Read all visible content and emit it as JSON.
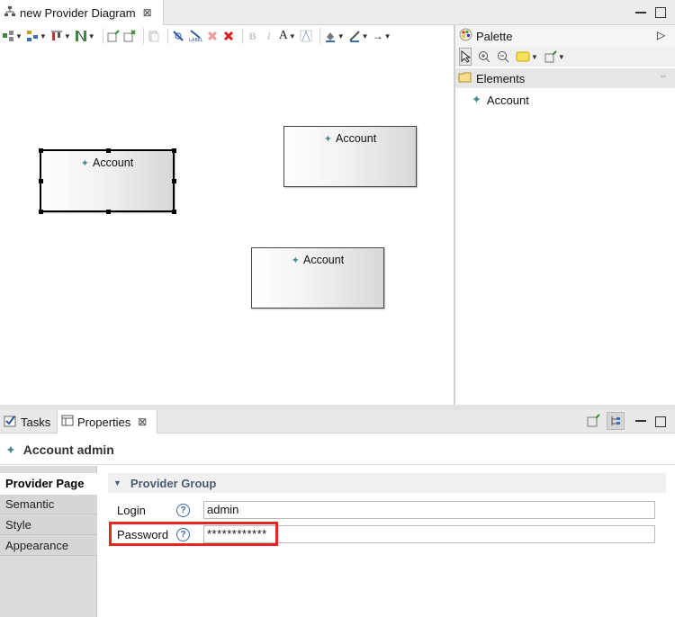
{
  "editor": {
    "tab_title": "new Provider Diagram",
    "close_glyph": "⊠"
  },
  "toolbar": {
    "bold": "B",
    "italic": "I",
    "font_color": "A",
    "arrow": "→"
  },
  "canvas": {
    "nodes": [
      {
        "label": "Account",
        "selected": true
      },
      {
        "label": "Account",
        "selected": false
      },
      {
        "label": "Account",
        "selected": false
      }
    ]
  },
  "palette": {
    "title": "Palette",
    "drawer_label": "Elements",
    "items": [
      {
        "label": "Account",
        "icon": "account-icon"
      }
    ]
  },
  "views": {
    "tasks_label": "Tasks",
    "properties_label": "Properties",
    "close_glyph": "⊠"
  },
  "properties": {
    "title": "Account admin",
    "tabs": [
      "Provider Page",
      "Semantic",
      "Style",
      "Appearance"
    ],
    "active_tab": "Provider Page",
    "group_title": "Provider Group",
    "fields": {
      "login_label": "Login",
      "login_value": "admin",
      "password_label": "Password",
      "password_value": "************"
    }
  },
  "colors": {
    "highlight": "#e8261b",
    "group_text": "#4a5b74",
    "help_icon": "#3b66a6",
    "node_icon": "#4f8a8a"
  }
}
